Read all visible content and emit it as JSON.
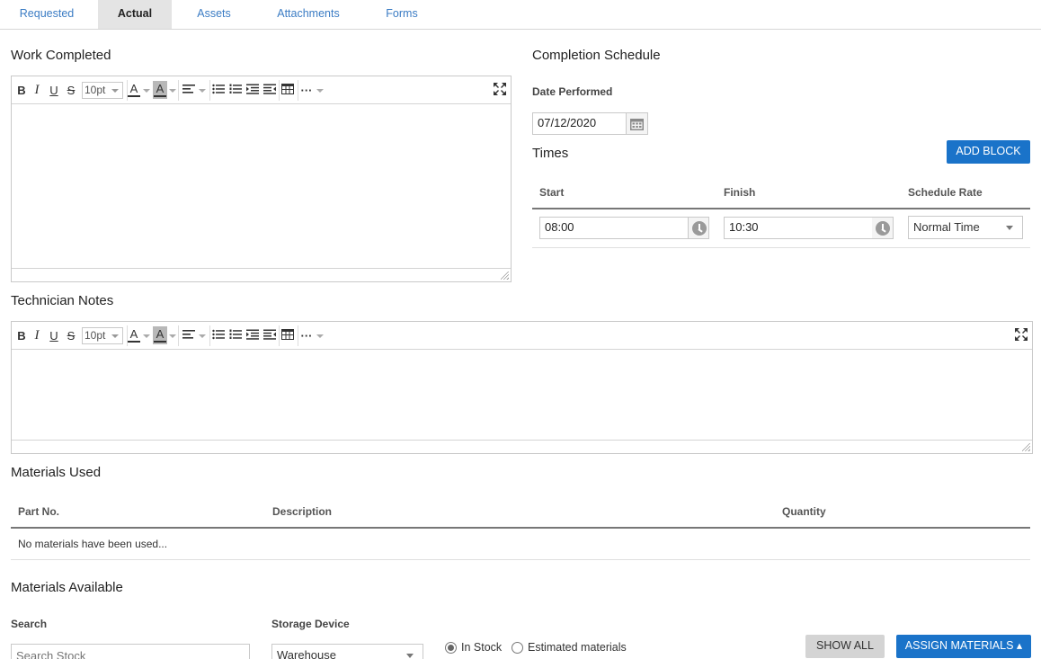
{
  "tabs": [
    {
      "label": "Requested"
    },
    {
      "label": "Actual"
    },
    {
      "label": "Assets"
    },
    {
      "label": "Attachments"
    },
    {
      "label": "Forms"
    }
  ],
  "active_tab": "Actual",
  "work_completed": {
    "title": "Work Completed",
    "font_size": "10pt"
  },
  "completion_schedule": {
    "title": "Completion Schedule",
    "date_label": "Date Performed",
    "date_value": "07/12/2020",
    "times_title": "Times",
    "add_block_label": "ADD BLOCK",
    "columns": [
      "Start",
      "Finish",
      "Schedule Rate"
    ],
    "row": {
      "start": "08:00",
      "finish": "10:30",
      "rate": "Normal Time"
    }
  },
  "technician_notes": {
    "title": "Technician Notes",
    "font_size": "10pt"
  },
  "materials_used": {
    "title": "Materials Used",
    "columns": [
      "Part No.",
      "Description",
      "Quantity"
    ],
    "empty_message": "No materials have been used..."
  },
  "materials_available": {
    "title": "Materials Available",
    "search_label": "Search",
    "search_placeholder": "Search Stock",
    "storage_label": "Storage Device",
    "storage_value": "Warehouse",
    "radio_in_stock": "In Stock",
    "radio_estimated": "Estimated materials",
    "show_all_label": "SHOW ALL",
    "assign_label": "ASSIGN MATERIALS ▴"
  },
  "colors": {
    "primary": "#1a73c9",
    "tab_link": "#3b7cc4",
    "active_tab_bg": "#e4e4e4"
  }
}
